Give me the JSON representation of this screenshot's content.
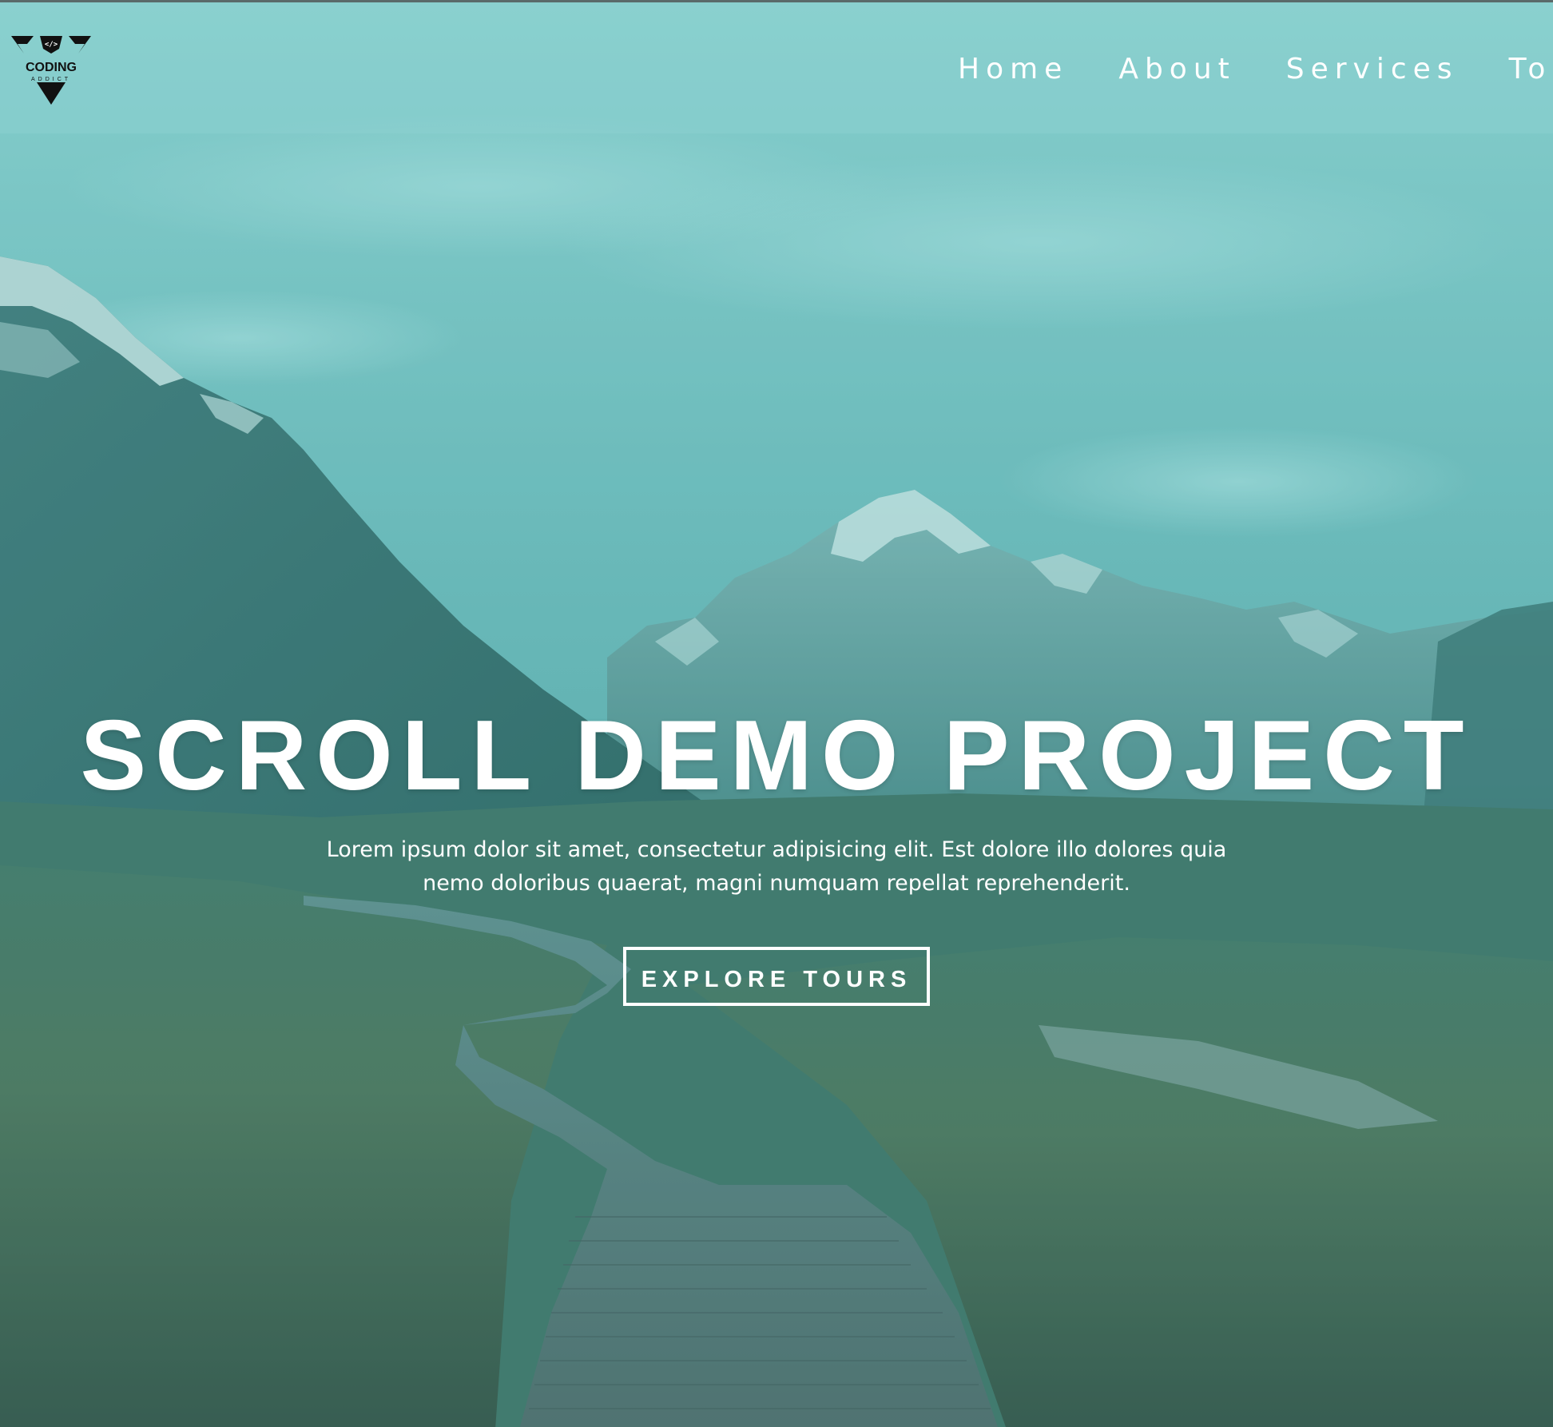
{
  "brand": {
    "logo_line1": "CODING",
    "logo_line2": "ADDICT"
  },
  "nav": {
    "items": [
      {
        "label": "Home"
      },
      {
        "label": "About"
      },
      {
        "label": "Services"
      },
      {
        "label": "Tours"
      }
    ]
  },
  "hero": {
    "title": "SCROLL DEMO PROJECT",
    "text": "Lorem ipsum dolor sit amet, consectetur adipisicing elit. Est dolore illo dolores quia nemo doloribus quaerat, magni numquam repellat reprehenderit.",
    "button_label": "EXPLORE TOURS"
  },
  "colors": {
    "overlay": "#5fb6b6",
    "text": "#ffffff"
  }
}
